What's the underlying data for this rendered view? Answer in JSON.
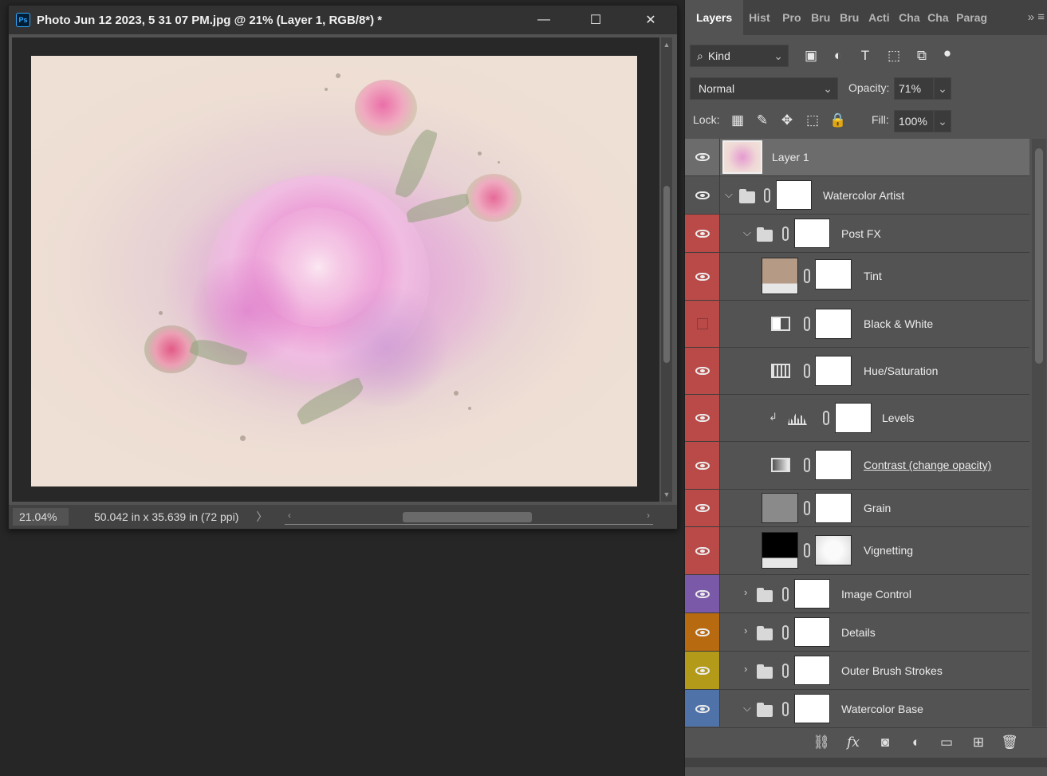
{
  "document": {
    "title": "Photo Jun 12 2023, 5 31 07 PM.jpg @ 21% (Layer 1, RGB/8*) *",
    "app_icon": "Ps",
    "zoom": "21.04%",
    "doc_info": "50.042 in x 35.639 in (72 ppi)",
    "window_controls": {
      "minimize": "—",
      "maximize": "☐",
      "close": "✕"
    }
  },
  "panel": {
    "tabs": [
      "Layers",
      "Hist",
      "Pro",
      "Bru",
      "Bru",
      "Acti",
      "Cha",
      "Cha",
      "Parag"
    ],
    "active_tab": "Layers",
    "filter_kind": "Kind",
    "blend_mode": "Normal",
    "opacity_label": "Opacity:",
    "opacity_value": "71%",
    "lock_label": "Lock:",
    "fill_label": "Fill:",
    "fill_value": "100%"
  },
  "layers": [
    {
      "name": "Layer 1",
      "visible": true,
      "label_color": "none",
      "selected": true
    },
    {
      "name": "Watercolor Artist",
      "visible": true,
      "label_color": "none",
      "type": "group",
      "expanded": true
    },
    {
      "name": "Post FX",
      "visible": true,
      "label_color": "#b94a48",
      "type": "group",
      "expanded": true
    },
    {
      "name": "Tint",
      "visible": true,
      "label_color": "#b94a48",
      "type": "fill"
    },
    {
      "name": "Black & White",
      "visible": false,
      "label_color": "#b94a48",
      "type": "adjustment"
    },
    {
      "name": "Hue/Saturation",
      "visible": true,
      "label_color": "#b94a48",
      "type": "adjustment"
    },
    {
      "name": "Levels",
      "visible": true,
      "label_color": "#b94a48",
      "type": "adjustment",
      "clipped": true
    },
    {
      "name": "Contrast (change opacity)",
      "visible": true,
      "label_color": "#b94a48",
      "type": "adjustment"
    },
    {
      "name": "Grain",
      "visible": true,
      "label_color": "#b94a48",
      "type": "pixel"
    },
    {
      "name": "Vignetting",
      "visible": true,
      "label_color": "#b94a48",
      "type": "fill"
    },
    {
      "name": "Image Control",
      "visible": true,
      "label_color": "#7a5aa8",
      "type": "group",
      "expanded": false
    },
    {
      "name": "Details",
      "visible": true,
      "label_color": "#b86a10",
      "type": "group",
      "expanded": false
    },
    {
      "name": "Outer Brush Strokes",
      "visible": true,
      "label_color": "#b39a18",
      "type": "group",
      "expanded": false
    },
    {
      "name": "Watercolor Base",
      "visible": true,
      "label_color": "#4f73a8",
      "type": "group",
      "expanded": true
    }
  ],
  "colors": {
    "accent_red": "#b94a48",
    "accent_purple": "#7a5aa8",
    "accent_orange": "#b86a10",
    "accent_yellow": "#b39a18",
    "accent_blue": "#4f73a8",
    "tint_swatch": "#b59a85"
  }
}
